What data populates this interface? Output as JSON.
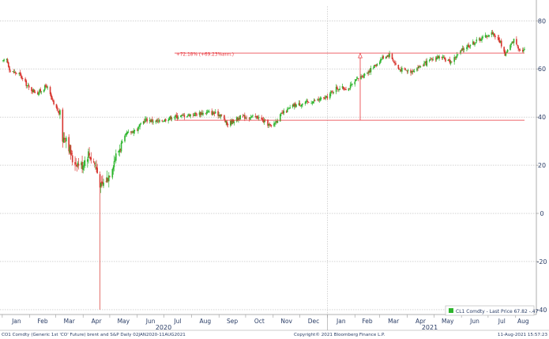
{
  "colors": {
    "up": "#2db52d",
    "down": "#d8352f",
    "annotation": "#e8363c",
    "grid": "#b9b9b9",
    "axis_text": "#2a3d66"
  },
  "footer": {
    "left": "CO1 Comdty (Generic 1st 'CO' Future) brent and S&P  Daily 02JAN2020-11AUG2021",
    "center": "Copyright© 2021 Bloomberg Finance L.P.",
    "right": "11-Aug-2021 15:57:23"
  },
  "legend": {
    "label": "CL1 Comdty - Last Price 67.82  -.47",
    "swatch_color": "#2db52d",
    "placement": "bottom-right"
  },
  "annotation": {
    "text": "+72.18% (+69.23%ann.)"
  },
  "chart_data": {
    "type": "candlestick",
    "title": "",
    "ylim": [
      -42,
      86
    ],
    "y_ticks": [
      80,
      60,
      40,
      20,
      0,
      -20,
      -40
    ],
    "x_range": [
      "2020-01-02",
      "2021-08-11"
    ],
    "months": [
      "Jan",
      "Feb",
      "Mar",
      "Apr",
      "May",
      "Jun",
      "Jul",
      "Aug",
      "Sep",
      "Oct",
      "Nov",
      "Dec",
      "Jan",
      "Feb",
      "Mar",
      "Apr",
      "May",
      "Jun",
      "Jul",
      "Aug"
    ],
    "years": [
      "2020",
      "2021"
    ],
    "grid": true,
    "series": [
      {
        "name": "CL1 Comdty",
        "last_price": 67.82,
        "change": -0.47,
        "path": [
          [
            "2020-01-02",
            63
          ],
          [
            "2020-01-06",
            64
          ],
          [
            "2020-01-10",
            59
          ],
          [
            "2020-01-20",
            58
          ],
          [
            "2020-01-31",
            52
          ],
          [
            "2020-02-10",
            50
          ],
          [
            "2020-02-20",
            53
          ],
          [
            "2020-02-28",
            45
          ],
          [
            "2020-03-06",
            41
          ],
          [
            "2020-03-09",
            31
          ],
          [
            "2020-03-13",
            32
          ],
          [
            "2020-03-20",
            22
          ],
          [
            "2020-03-31",
            20
          ],
          [
            "2020-04-07",
            25
          ],
          [
            "2020-04-15",
            20
          ],
          [
            "2020-04-21",
            11
          ],
          [
            "2020-04-29",
            15
          ],
          [
            "2020-05-08",
            24
          ],
          [
            "2020-05-20",
            33
          ],
          [
            "2020-06-01",
            35
          ],
          [
            "2020-06-10",
            39
          ],
          [
            "2020-06-25",
            38
          ],
          [
            "2020-07-10",
            40
          ],
          [
            "2020-07-31",
            41
          ],
          [
            "2020-08-20",
            42
          ],
          [
            "2020-09-03",
            41
          ],
          [
            "2020-09-10",
            37
          ],
          [
            "2020-09-25",
            40
          ],
          [
            "2020-10-15",
            40
          ],
          [
            "2020-10-30",
            36
          ],
          [
            "2020-11-10",
            41
          ],
          [
            "2020-11-25",
            45
          ],
          [
            "2020-12-10",
            46
          ],
          [
            "2020-12-31",
            48
          ],
          [
            "2021-01-10",
            52
          ],
          [
            "2021-01-25",
            52
          ],
          [
            "2021-02-05",
            56
          ],
          [
            "2021-02-20",
            60
          ],
          [
            "2021-03-05",
            65
          ],
          [
            "2021-03-12",
            66
          ],
          [
            "2021-03-22",
            60
          ],
          [
            "2021-04-05",
            59
          ],
          [
            "2021-04-20",
            62
          ],
          [
            "2021-05-05",
            65
          ],
          [
            "2021-05-20",
            63
          ],
          [
            "2021-06-05",
            69
          ],
          [
            "2021-06-25",
            73
          ],
          [
            "2021-07-06",
            75
          ],
          [
            "2021-07-15",
            71
          ],
          [
            "2021-07-20",
            66
          ],
          [
            "2021-07-30",
            72
          ],
          [
            "2021-08-06",
            68
          ],
          [
            "2021-08-11",
            67.82
          ]
        ],
        "spike": {
          "date": "2020-04-20",
          "low": -40
        }
      }
    ],
    "measurement": {
      "start_date": "2020-07-13",
      "end_date": "2021-02-07",
      "low_level": 38.7,
      "high_level": 66.6,
      "right_end_date": "2021-08-11"
    }
  }
}
